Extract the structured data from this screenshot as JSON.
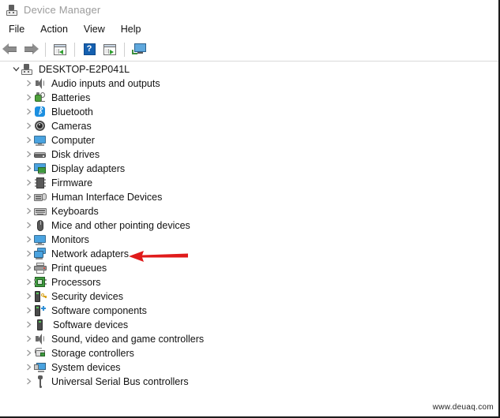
{
  "window": {
    "title": "Device Manager",
    "title_icon": "device-manager-icon"
  },
  "menubar": {
    "items": [
      {
        "label": "File"
      },
      {
        "label": "Action"
      },
      {
        "label": "View"
      },
      {
        "label": "Help"
      }
    ]
  },
  "toolbar": {
    "buttons": [
      {
        "name": "back-button",
        "icon": "back-arrow-icon"
      },
      {
        "name": "forward-button",
        "icon": "forward-arrow-icon"
      },
      {
        "name": "properties-button",
        "icon": "properties-icon"
      },
      {
        "name": "help-button",
        "icon": "help-question-icon",
        "glyph": "?"
      },
      {
        "name": "scan-hardware-changes-button",
        "icon": "scan-icon"
      },
      {
        "name": "update-driver-button",
        "icon": "monitor-plug-icon"
      }
    ]
  },
  "tree": {
    "root": {
      "label": "DESKTOP-E2P041L",
      "icon": "device-manager-icon",
      "expanded": true
    },
    "items": [
      {
        "label": "Audio inputs and outputs",
        "icon": "speaker-icon"
      },
      {
        "label": "Batteries",
        "icon": "battery-icon"
      },
      {
        "label": "Bluetooth",
        "icon": "bluetooth-icon"
      },
      {
        "label": "Cameras",
        "icon": "camera-icon"
      },
      {
        "label": "Computer",
        "icon": "monitor-icon"
      },
      {
        "label": "Disk drives",
        "icon": "disk-drive-icon"
      },
      {
        "label": "Display adapters",
        "icon": "display-adapter-icon"
      },
      {
        "label": "Firmware",
        "icon": "firmware-chip-icon"
      },
      {
        "label": "Human Interface Devices",
        "icon": "hid-icon"
      },
      {
        "label": "Keyboards",
        "icon": "keyboard-icon"
      },
      {
        "label": "Mice and other pointing devices",
        "icon": "mouse-icon"
      },
      {
        "label": "Monitors",
        "icon": "monitor-icon"
      },
      {
        "label": "Network adapters",
        "icon": "network-adapter-icon"
      },
      {
        "label": "Print queues",
        "icon": "printer-icon"
      },
      {
        "label": "Processors",
        "icon": "processor-icon"
      },
      {
        "label": "Security devices",
        "icon": "security-device-icon"
      },
      {
        "label": "Software components",
        "icon": "software-component-icon"
      },
      {
        "label": "Software devices",
        "icon": "software-device-icon"
      },
      {
        "label": "Sound, video and game controllers",
        "icon": "speaker-icon"
      },
      {
        "label": "Storage controllers",
        "icon": "storage-controller-icon"
      },
      {
        "label": "System devices",
        "icon": "system-device-icon"
      },
      {
        "label": "Universal Serial Bus controllers",
        "icon": "usb-icon"
      }
    ]
  },
  "annotation": {
    "arrow": {
      "name": "red-pointer-arrow",
      "points_to": "Network adapters",
      "color": "#e01b1b",
      "direction": "left"
    }
  },
  "watermark": {
    "text": "www.deuaq.com"
  }
}
